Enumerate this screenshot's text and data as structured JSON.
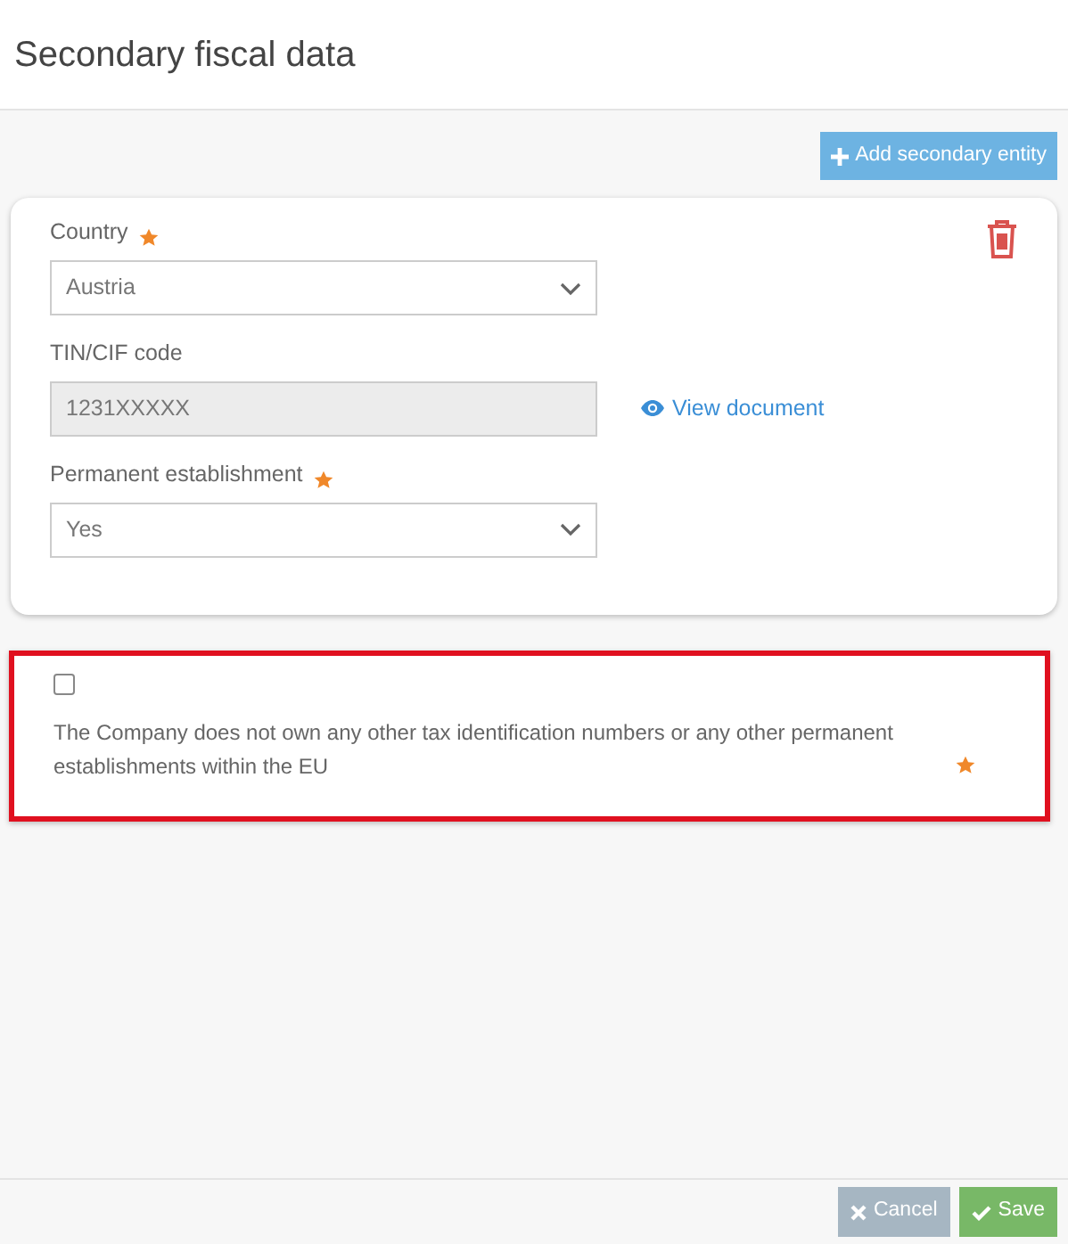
{
  "header": {
    "title": "Secondary fiscal data"
  },
  "add_button": {
    "label": "Add secondary entity"
  },
  "entity": {
    "fields": [
      {
        "kind": "select",
        "label": "Country",
        "required": true,
        "value": "Austria"
      },
      {
        "kind": "text",
        "label": "TIN/CIF code",
        "required": false,
        "value": "1231XXXXX",
        "disabled": true,
        "link": "View document"
      },
      {
        "kind": "select",
        "label": "Permanent establishment",
        "required": true,
        "value": "Yes"
      }
    ]
  },
  "declaration": {
    "checked": false,
    "highlighted": true,
    "text": "The Company does not own any other tax identification numbers or any other permanent establishments within the EU",
    "required": true
  },
  "footer": {
    "buttons": [
      {
        "kind": "cancel",
        "label": "Cancel"
      },
      {
        "kind": "save",
        "label": "Save"
      }
    ]
  }
}
